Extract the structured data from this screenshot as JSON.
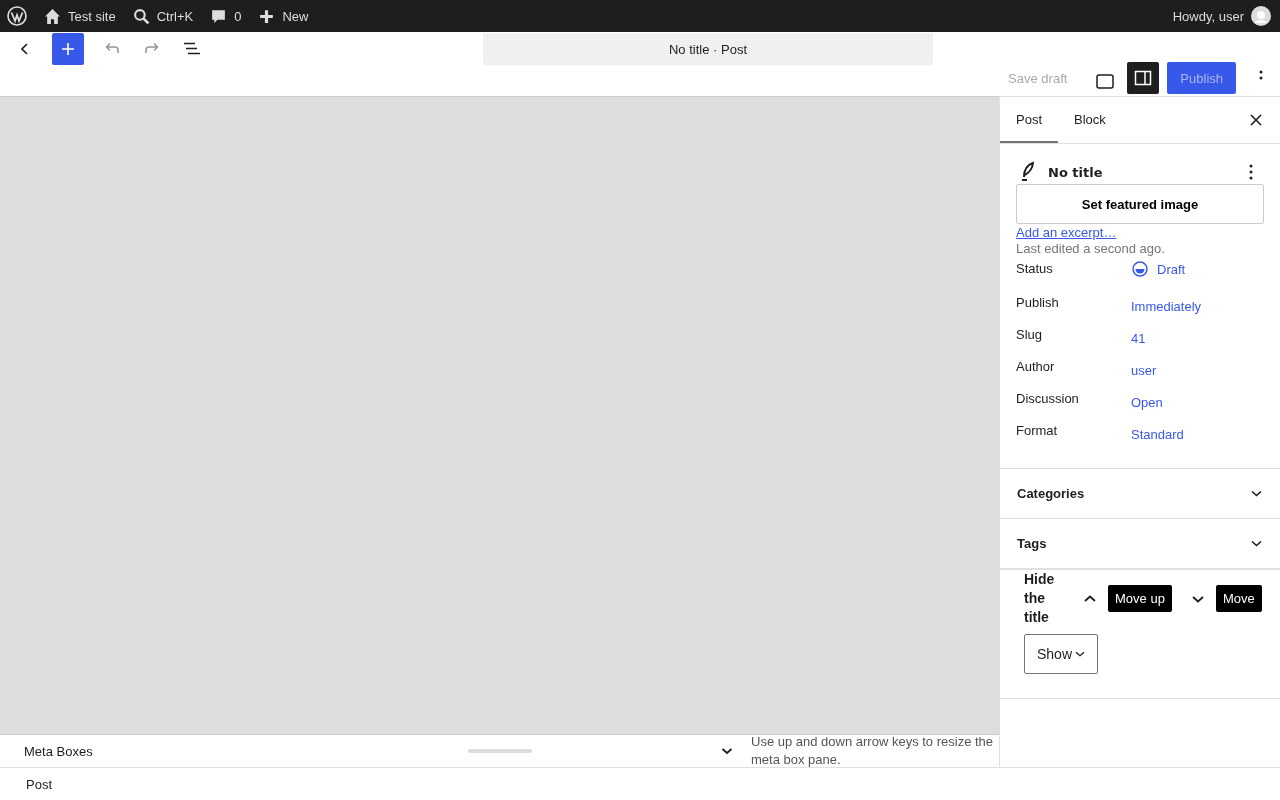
{
  "admin_bar": {
    "site": "Test site",
    "search": "Ctrl+K",
    "comments": "0",
    "new": "New",
    "greeting": "Howdy, user"
  },
  "header": {
    "document_title": "No title · Post",
    "save_draft": "Save draft",
    "publish": "Publish",
    "settings_selected": true
  },
  "sidebar": {
    "tabs": [
      {
        "label": "Post",
        "selected": true
      },
      {
        "label": "Block",
        "selected": false
      }
    ],
    "post_title": "No title",
    "featured_image": "Set featured image",
    "excerpt_link": "Add an excerpt…",
    "last_edited": "Last edited a second ago.",
    "fields": [
      {
        "label": "Status",
        "value": "Draft",
        "kind": "status"
      },
      {
        "label": "Publish",
        "value": "Immediately",
        "kind": "link"
      },
      {
        "label": "Slug",
        "value": "41",
        "kind": "link"
      },
      {
        "label": "Author",
        "value": "user",
        "kind": "link"
      },
      {
        "label": "Discussion",
        "value": "Open",
        "kind": "link"
      },
      {
        "label": "Format",
        "value": "Standard",
        "kind": "link"
      }
    ],
    "panels": [
      {
        "title": "Categories",
        "expanded": false
      },
      {
        "title": "Tags",
        "expanded": false
      }
    ],
    "hide_title": {
      "label": "Hide the title",
      "tooltips": [
        "Move up",
        "Move"
      ],
      "select_value": "Show"
    }
  },
  "meta_boxes": {
    "title": "Meta Boxes",
    "hint": "Use up and down arrow keys to resize the meta box pane."
  },
  "footer": {
    "breadcrumb": "Post"
  }
}
